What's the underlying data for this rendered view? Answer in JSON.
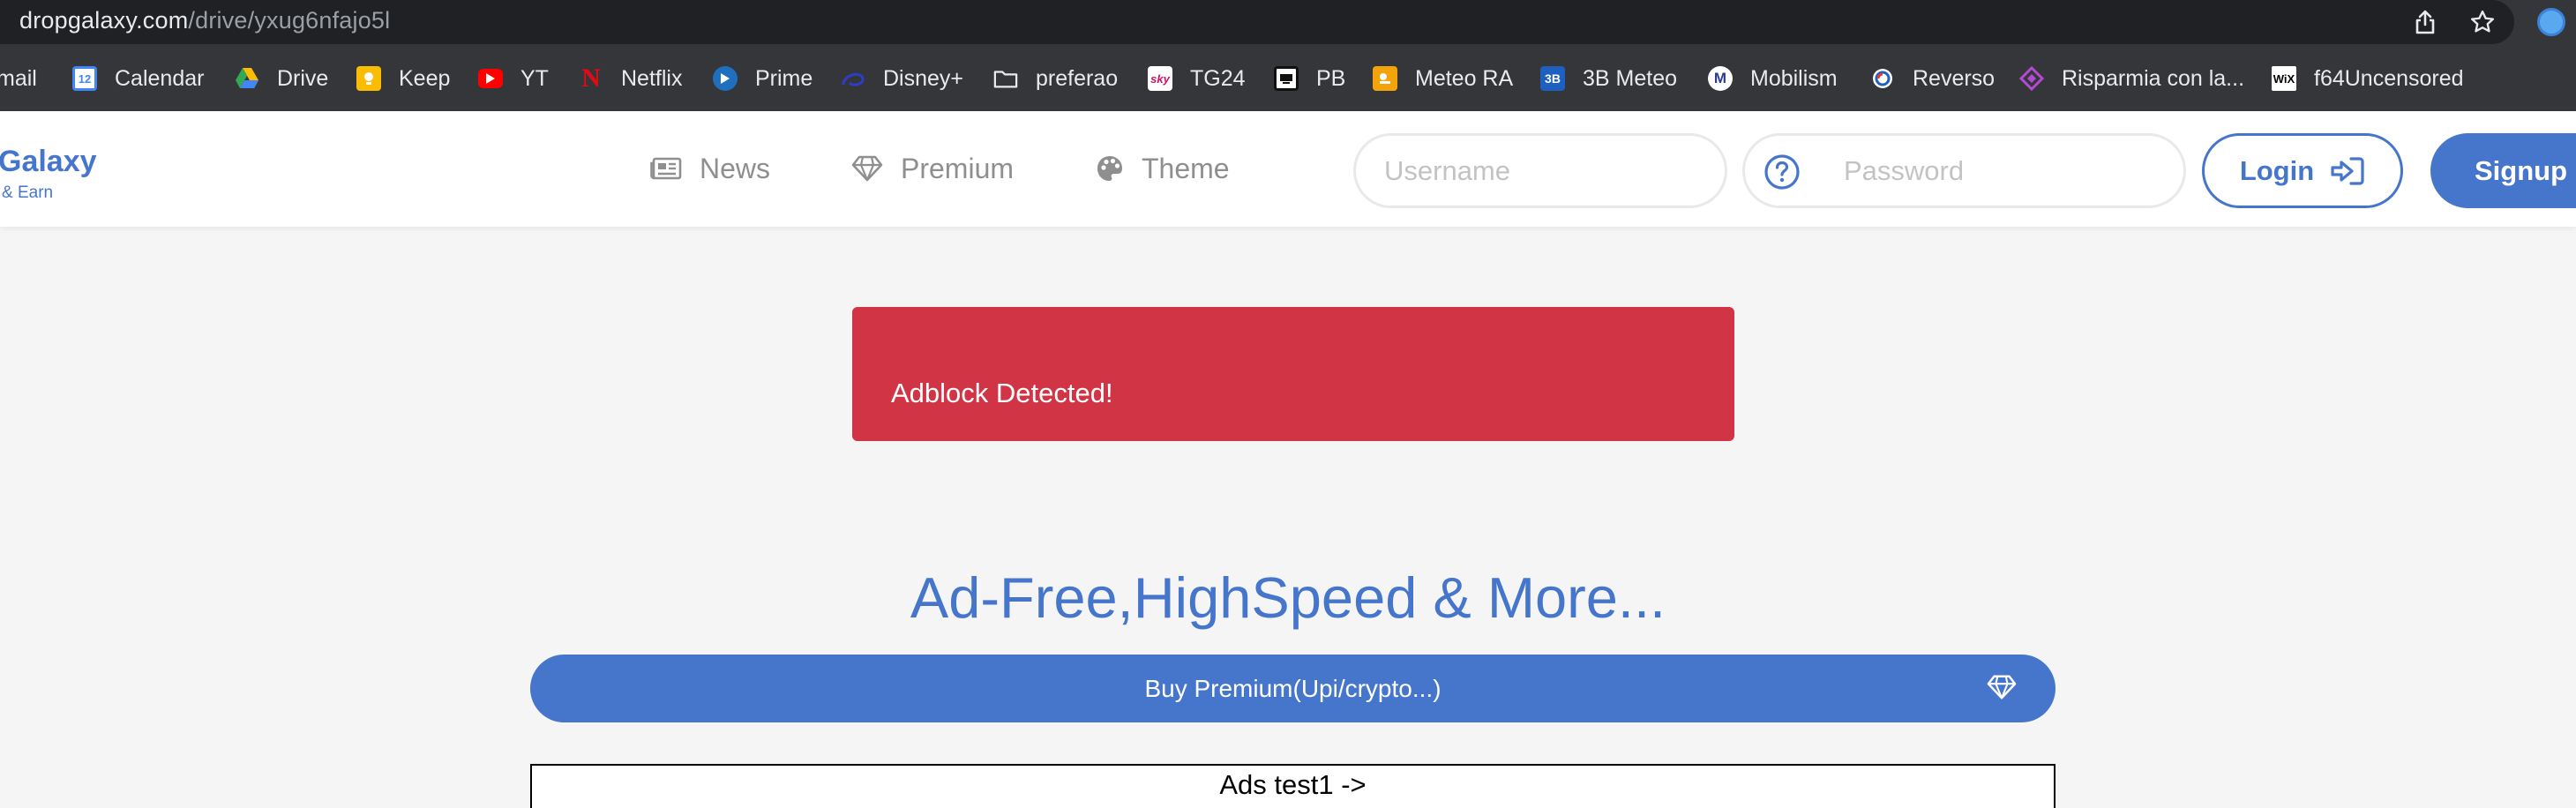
{
  "browser": {
    "url_domain": "dropgalaxy.com",
    "url_path": "/drive/yxug6nfajo5l"
  },
  "bookmarks": [
    {
      "label": "mail",
      "icon": "gmail-icon"
    },
    {
      "label": "Calendar",
      "icon": "calendar-icon",
      "badge": "12"
    },
    {
      "label": "Drive",
      "icon": "drive-icon"
    },
    {
      "label": "Keep",
      "icon": "keep-icon"
    },
    {
      "label": "YT",
      "icon": "youtube-icon"
    },
    {
      "label": "Netflix",
      "icon": "netflix-icon",
      "badge": "N"
    },
    {
      "label": "Prime",
      "icon": "prime-video-icon"
    },
    {
      "label": "Disney+",
      "icon": "disney-icon"
    },
    {
      "label": "preferao",
      "icon": "folder-icon"
    },
    {
      "label": "TG24",
      "icon": "sky-tg24-icon",
      "badge": "sky"
    },
    {
      "label": "PB",
      "icon": "pb-icon"
    },
    {
      "label": "Meteo RA",
      "icon": "meteo-ra-icon"
    },
    {
      "label": "3B Meteo",
      "icon": "3bmeteo-icon",
      "badge": "3B"
    },
    {
      "label": "Mobilism",
      "icon": "mobilism-icon",
      "badge": "M"
    },
    {
      "label": "Reverso",
      "icon": "reverso-icon"
    },
    {
      "label": "Risparmia con la...",
      "icon": "risparmia-icon"
    },
    {
      "label": "f64Uncensored",
      "icon": "wix-icon",
      "badge": "WiX"
    }
  ],
  "header": {
    "logo_title": "Galaxy",
    "logo_subtitle": "& Earn",
    "nav": {
      "news": "News",
      "premium": "Premium",
      "theme": "Theme"
    },
    "username_placeholder": "Username",
    "password_placeholder": "Password",
    "login_label": "Login",
    "signup_label": "Signup"
  },
  "main": {
    "alert_text": "Adblock Detected!",
    "promo_title": "Ad-Free,HighSpeed & More...",
    "buy_button_label": "Buy Premium(Upi/crypto...)",
    "ads_text": "Ads test1 ->"
  },
  "colors": {
    "brand": "#4676cc",
    "alert": "#d13445",
    "chrome_bg": "#35363a"
  }
}
